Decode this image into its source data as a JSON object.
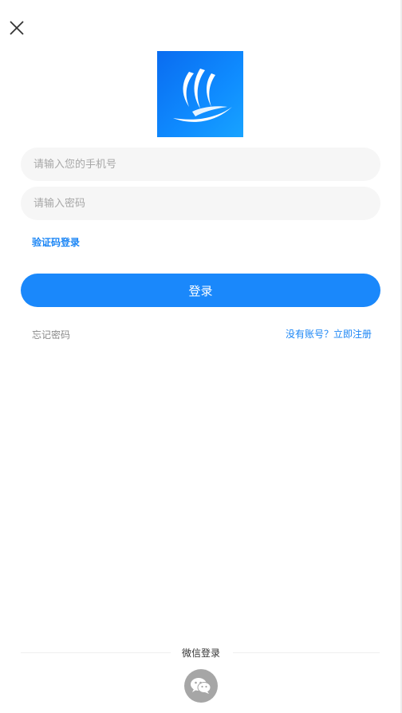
{
  "header": {
    "close_icon": "close-icon"
  },
  "logo": {
    "icon": "sail-logo-icon",
    "colors": {
      "from": "#0a6cf0",
      "to": "#18a3ff"
    }
  },
  "form": {
    "phone_placeholder": "请输入您的手机号",
    "password_placeholder": "请输入密码",
    "sms_login_label": "验证码登录",
    "login_label": "登录",
    "forgot_password_label": "忘记密码",
    "register_label": "没有账号？立即注册"
  },
  "third_party": {
    "wechat_label": "微信登录",
    "wechat_icon": "wechat-icon"
  },
  "colors": {
    "accent": "#1a88fb",
    "field_bg": "#f6f6f6",
    "wechat_bg": "#a6a6a6"
  }
}
